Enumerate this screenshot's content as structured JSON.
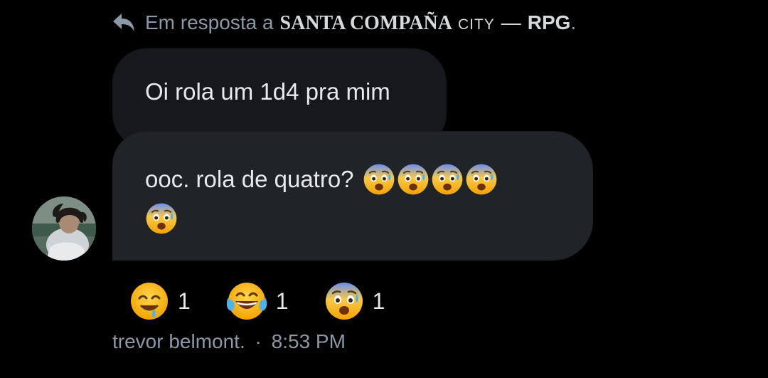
{
  "reply_header": {
    "prefix": "Em resposta a",
    "target_name": "SANTA COMPAÑA",
    "target_city": "CITY",
    "separator": "—",
    "target_suffix": "RPG",
    "trailing": ".",
    "icon": "reply-arrow-icon"
  },
  "messages": {
    "quoted": {
      "text": "Oi rola um 1d4 pra mim"
    },
    "main": {
      "text": "ooc. rola de quatro?",
      "emojis_line1": [
        "anxious-face",
        "anxious-face",
        "anxious-face",
        "anxious-face"
      ],
      "emojis_line2": [
        "anxious-face"
      ]
    }
  },
  "reactions": [
    {
      "emoji": "drooling-face",
      "count": "1"
    },
    {
      "emoji": "tears-of-joy-face",
      "count": "1"
    },
    {
      "emoji": "anxious-face",
      "count": "1"
    }
  ],
  "meta": {
    "author": "trevor belmont.",
    "separator": "·",
    "time": "8:53 PM"
  },
  "colors": {
    "background": "#000000",
    "bubble": "#202327",
    "bubble_quoted": "#16181c",
    "text": "#e7e9ea",
    "muted": "#8b98a5"
  }
}
